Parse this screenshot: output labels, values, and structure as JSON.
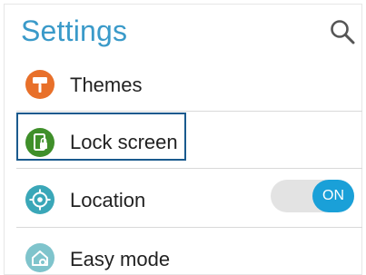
{
  "header": {
    "title": "Settings",
    "search_icon": "search-icon"
  },
  "list": {
    "items": [
      {
        "label": "Themes",
        "icon": "paint-roller-icon",
        "icon_color": "#e8702a"
      },
      {
        "label": "Lock screen",
        "icon": "lock-screen-icon",
        "icon_color": "#3f8f2a",
        "focused": true
      },
      {
        "label": "Location",
        "icon": "location-crosshair-icon",
        "icon_color": "#3aa7b8",
        "toggle": {
          "state": "ON",
          "on": true
        }
      },
      {
        "label": "Easy mode",
        "icon": "easy-mode-home-icon",
        "icon_color": "#7fc4cc"
      }
    ]
  },
  "colors": {
    "accent": "#3a9ac9",
    "toggle_on": "#1aa0d8",
    "focus_border": "#1a5a8e",
    "divider": "#d9d9d9"
  }
}
